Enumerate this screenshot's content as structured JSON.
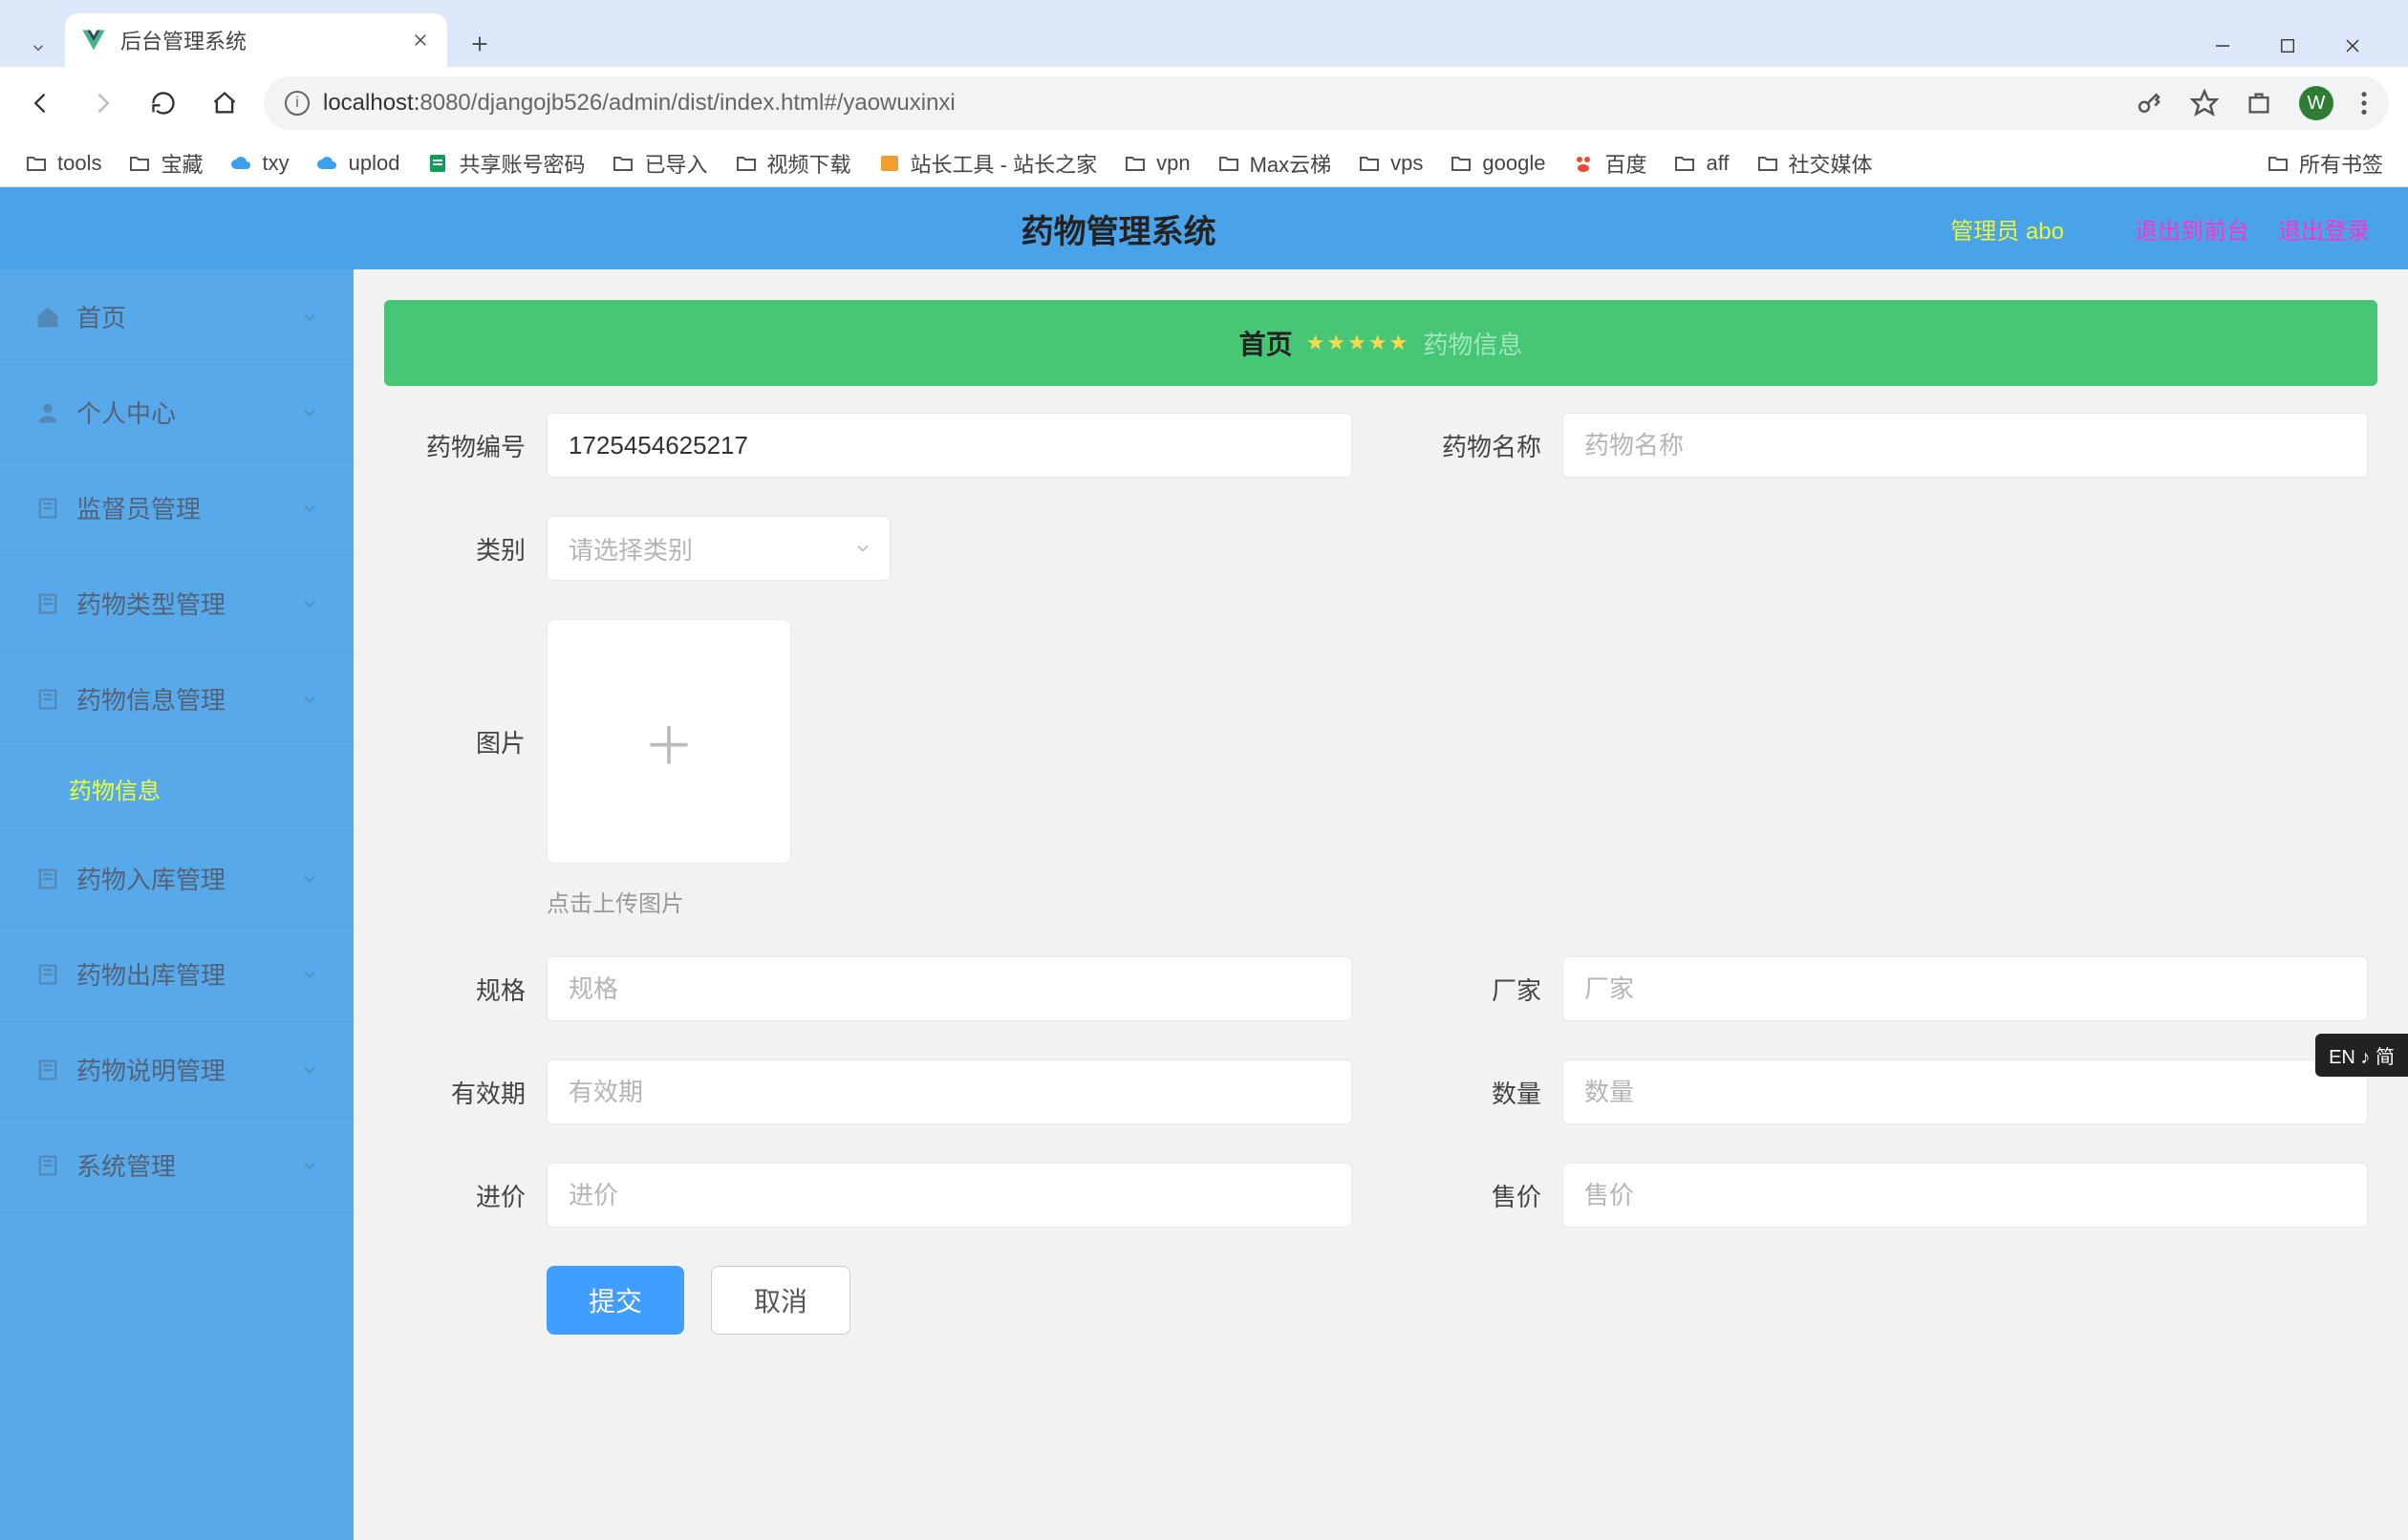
{
  "browser": {
    "tab_title": "后台管理系统",
    "url_host": "localhost:",
    "url_port_path": "8080/djangojb526/admin/dist/index.html#/yaowuxinxi",
    "profile_initial": "W"
  },
  "bookmarks": [
    {
      "label": "tools",
      "icon": "folder"
    },
    {
      "label": "宝藏",
      "icon": "folder"
    },
    {
      "label": "txy",
      "icon": "cloud"
    },
    {
      "label": "uplod",
      "icon": "cloud"
    },
    {
      "label": "共享账号密码",
      "icon": "sheets"
    },
    {
      "label": "已导入",
      "icon": "folder"
    },
    {
      "label": "视频下载",
      "icon": "folder"
    },
    {
      "label": "站长工具 - 站长之家",
      "icon": "site"
    },
    {
      "label": "vpn",
      "icon": "folder"
    },
    {
      "label": "Max云梯",
      "icon": "folder"
    },
    {
      "label": "vps",
      "icon": "folder"
    },
    {
      "label": "google",
      "icon": "folder"
    },
    {
      "label": "百度",
      "icon": "baidu"
    },
    {
      "label": "aff",
      "icon": "folder"
    },
    {
      "label": "社交媒体",
      "icon": "folder"
    }
  ],
  "all_bookmarks_label": "所有书签",
  "app_header": {
    "title": "药物管理系统",
    "user": "管理员 abo",
    "logout_front": "退出到前台",
    "logout": "退出登录"
  },
  "sidebar": {
    "items": [
      {
        "label": "首页",
        "icon": "home"
      },
      {
        "label": "个人中心",
        "icon": "user"
      },
      {
        "label": "监督员管理",
        "icon": "doc"
      },
      {
        "label": "药物类型管理",
        "icon": "doc"
      },
      {
        "label": "药物信息管理",
        "icon": "doc",
        "active": true,
        "sub": "药物信息"
      },
      {
        "label": "药物入库管理",
        "icon": "doc"
      },
      {
        "label": "药物出库管理",
        "icon": "doc"
      },
      {
        "label": "药物说明管理",
        "icon": "doc"
      },
      {
        "label": "系统管理",
        "icon": "doc"
      }
    ]
  },
  "breadcrumb": {
    "home": "首页",
    "stars": "★★★★★",
    "current": "药物信息"
  },
  "form": {
    "drug_id_label": "药物编号",
    "drug_id_value": "1725454625217",
    "drug_name_label": "药物名称",
    "drug_name_placeholder": "药物名称",
    "category_label": "类别",
    "category_placeholder": "请选择类别",
    "image_label": "图片",
    "upload_hint": "点击上传图片",
    "spec_label": "规格",
    "spec_placeholder": "规格",
    "manufacturer_label": "厂家",
    "manufacturer_placeholder": "厂家",
    "expiry_label": "有效期",
    "expiry_placeholder": "有效期",
    "quantity_label": "数量",
    "quantity_placeholder": "数量",
    "purchase_price_label": "进价",
    "purchase_price_placeholder": "进价",
    "sale_price_label": "售价",
    "sale_price_placeholder": "售价",
    "submit": "提交",
    "cancel": "取消"
  },
  "ime": "EN ♪ 简"
}
